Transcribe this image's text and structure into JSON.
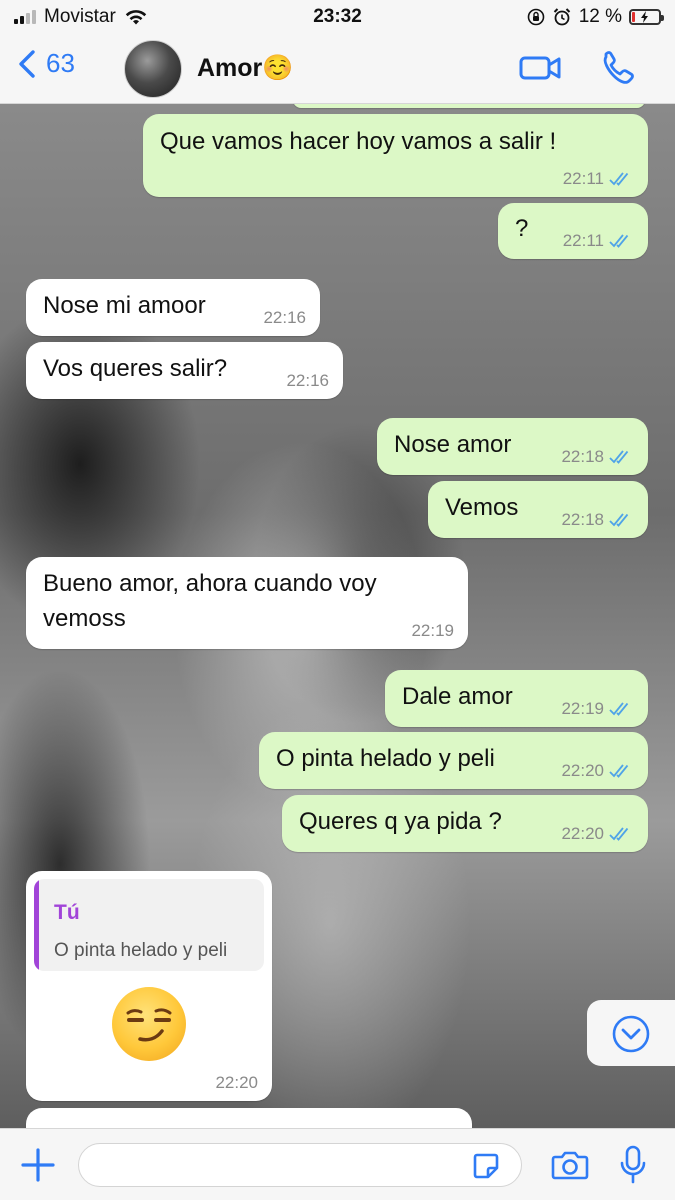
{
  "status_bar": {
    "carrier": "Movistar",
    "time": "23:32",
    "battery_text": "12 %",
    "battery_level": 0.12,
    "signal_bars": 2
  },
  "header": {
    "back_count": "63",
    "contact_name": "Amor☺️",
    "icons": [
      "video-call-icon",
      "phone-call-icon"
    ]
  },
  "messages": [
    {
      "dir": "out",
      "text": "Que vamos hacer hoy vamos a salir !",
      "time": "22:11",
      "read": true
    },
    {
      "dir": "out",
      "text": "?",
      "time": "22:11",
      "read": true
    },
    {
      "dir": "in",
      "text": "Nose mi amoor",
      "time": "22:16"
    },
    {
      "dir": "in",
      "text": "Vos queres salir?",
      "time": "22:16"
    },
    {
      "dir": "out",
      "text": "Nose amor",
      "time": "22:18",
      "read": true
    },
    {
      "dir": "out",
      "text": "Vemos",
      "time": "22:18",
      "read": true
    },
    {
      "dir": "in",
      "text_line1": "Bueno amor, ahora cuando voy",
      "text_line2": "vemoss",
      "time": "22:19"
    },
    {
      "dir": "out",
      "text": "Dale amor",
      "time": "22:19",
      "read": true
    },
    {
      "dir": "out",
      "text": "O pinta helado y peli",
      "time": "22:20",
      "read": true
    },
    {
      "dir": "out",
      "text": "Queres q ya pida ?",
      "time": "22:20",
      "read": true
    },
    {
      "dir": "in",
      "quote_author": "Tú",
      "quote_text": "O pinta helado y peli",
      "emoji": "smirking-face",
      "time": "22:20"
    }
  ],
  "colors": {
    "accent": "#2f7bf5",
    "outgoing_bubble": "#dcf8c6",
    "incoming_bubble": "#ffffff",
    "read_ticks": "#4fa3e8",
    "quote_accent": "#a144d8",
    "battery_low": "#e0312f"
  },
  "input": {
    "value": "",
    "placeholder": ""
  }
}
